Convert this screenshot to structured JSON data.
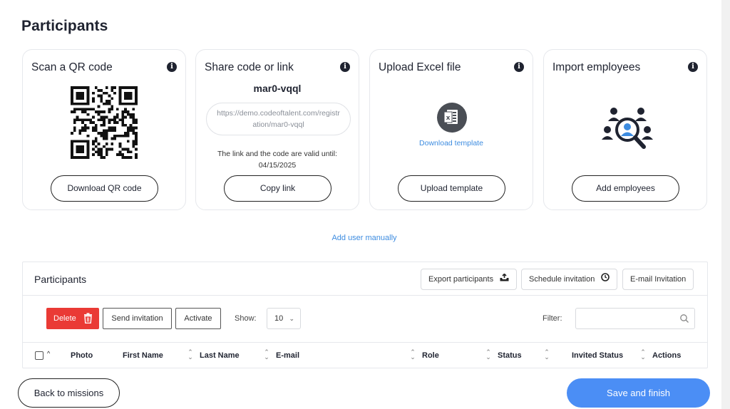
{
  "page": {
    "title": "Participants"
  },
  "cards": {
    "qr": {
      "title": "Scan a QR code",
      "button": "Download QR code",
      "icon": "qr-code-icon"
    },
    "share": {
      "title": "Share code or link",
      "code": "mar0-vqql",
      "link": "https://demo.codeoftalent.com/registration/mar0-vqql",
      "valid_text": "The link and the code are valid until:",
      "valid_date": "04/15/2025",
      "button": "Copy link"
    },
    "excel": {
      "title": "Upload Excel file",
      "download_link": "Download template",
      "button": "Upload template",
      "icon": "excel-file-icon"
    },
    "import": {
      "title": "Import employees",
      "button": "Add employees",
      "icon": "employees-search-icon"
    }
  },
  "add_user_manually": "Add user manually",
  "table": {
    "title": "Participants",
    "header_buttons": {
      "export": "Export participants",
      "schedule": "Schedule invitation",
      "email": "E-mail Invitation"
    },
    "toolbar": {
      "delete": "Delete",
      "send_invitation": "Send invitation",
      "activate": "Activate",
      "show_label": "Show:",
      "show_value": "10",
      "filter_label": "Filter:",
      "filter_value": ""
    },
    "columns": [
      "Photo",
      "First Name",
      "Last Name",
      "E-mail",
      "Role",
      "Status",
      "Invited Status",
      "Actions"
    ]
  },
  "footer": {
    "back": "Back to missions",
    "save": "Save and finish"
  },
  "colors": {
    "accent": "#4b8ef5",
    "danger": "#ea3a35",
    "link": "#3d8ce0"
  }
}
